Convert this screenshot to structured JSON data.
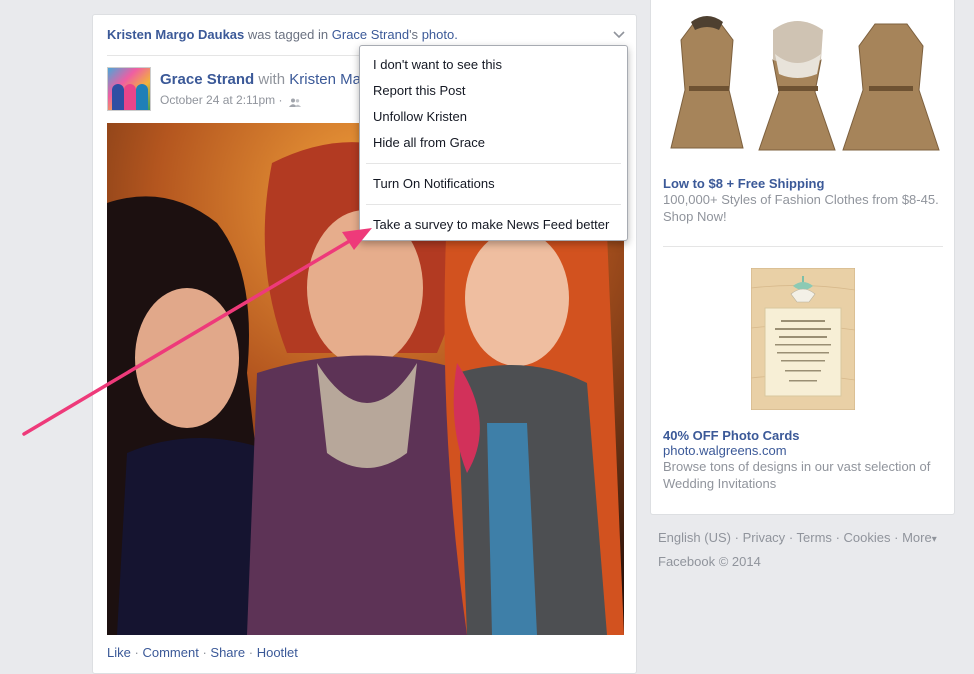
{
  "story": {
    "header": {
      "actor": "Kristen Margo Daukas",
      "verb": "was tagged in",
      "owner": "Grace Strand",
      "owner_suffix": "'s",
      "object": "photo."
    },
    "author": {
      "name": "Grace Strand",
      "with_label": "with",
      "tagged": "Kristen Ma"
    },
    "meta": {
      "date": "October 24 at 2:11pm",
      "separator": "·"
    },
    "actions": [
      "Like",
      "Comment",
      "Share",
      "Hootlet"
    ],
    "action_separator": "·"
  },
  "menu": {
    "items_group1": [
      "I don't want to see this",
      "Report this Post",
      "Unfollow Kristen",
      "Hide all from Grace"
    ],
    "items_group2": [
      "Turn On Notifications"
    ],
    "items_group3": [
      "Take a survey to make News Feed better"
    ]
  },
  "ads": [
    {
      "title": "Low to $8 + Free Shipping",
      "body": "100,000+ Styles of Fashion Clothes from $8-45. Shop Now!"
    },
    {
      "title": "40% OFF Photo Cards",
      "domain": "photo.walgreens.com",
      "body": "Browse tons of designs in our vast selection of Wedding Invitations"
    }
  ],
  "footer": {
    "links": [
      "English (US)",
      "Privacy",
      "Terms",
      "Cookies",
      "More"
    ],
    "separator": "·",
    "more_caret": "▾",
    "copyright": "Facebook © 2014"
  },
  "colors": {
    "link": "#3b5998",
    "muted": "#90949c",
    "page_bg": "#e9eaed",
    "annotation_arrow": "#ee3a7a"
  },
  "icons": {
    "chevron": "chevron-down-icon",
    "audience": "friends-icon"
  }
}
